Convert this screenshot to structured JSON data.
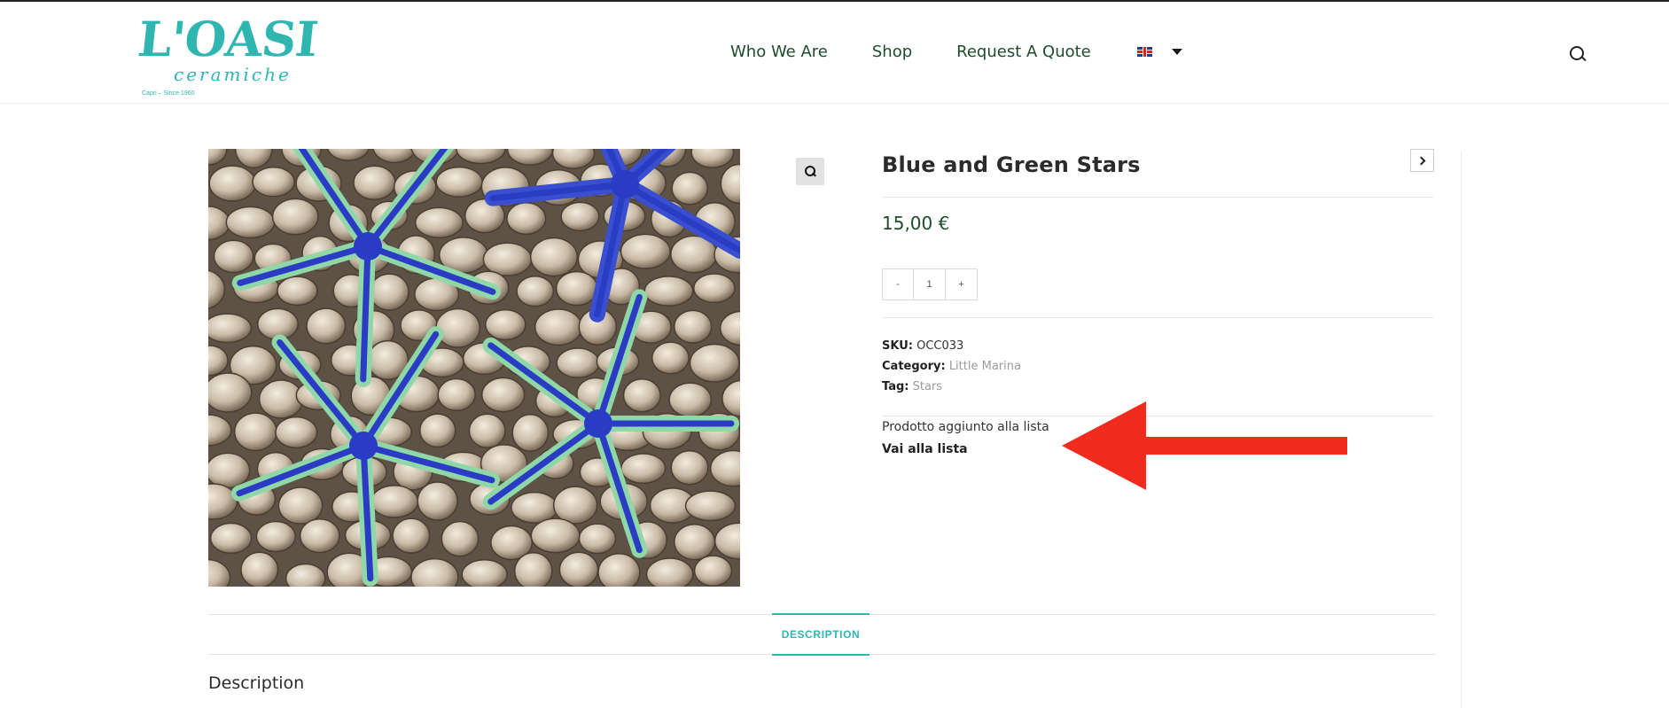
{
  "header": {
    "logo": {
      "main": "L'OASI",
      "sub": "ceramiche",
      "tagline": "Capri – Since 1960"
    },
    "nav": [
      {
        "label": "Who We Are"
      },
      {
        "label": "Shop"
      },
      {
        "label": "Request A Quote"
      }
    ],
    "language": {
      "flag": "uk-flag-icon"
    }
  },
  "product": {
    "title": "Blue and Green Stars",
    "price": "15,00 €",
    "quantity": {
      "minus": "-",
      "value": "1",
      "plus": "+"
    },
    "meta": {
      "sku_label": "SKU:",
      "sku": "OCC033",
      "category_label": "Category:",
      "category": "Little Marina",
      "tag_label": "Tag:",
      "tag": "Stars"
    },
    "wishlist": {
      "message": "Prodotto aggiunto alla lista",
      "link": "Vai alla lista"
    }
  },
  "tabs": [
    {
      "label": "DESCRIPTION",
      "active": true
    }
  ],
  "description": {
    "heading": "Description"
  },
  "colors": {
    "accent": "#2fb6b0",
    "nav_text": "#1d4d2c",
    "arrow": "#f22b1f"
  }
}
